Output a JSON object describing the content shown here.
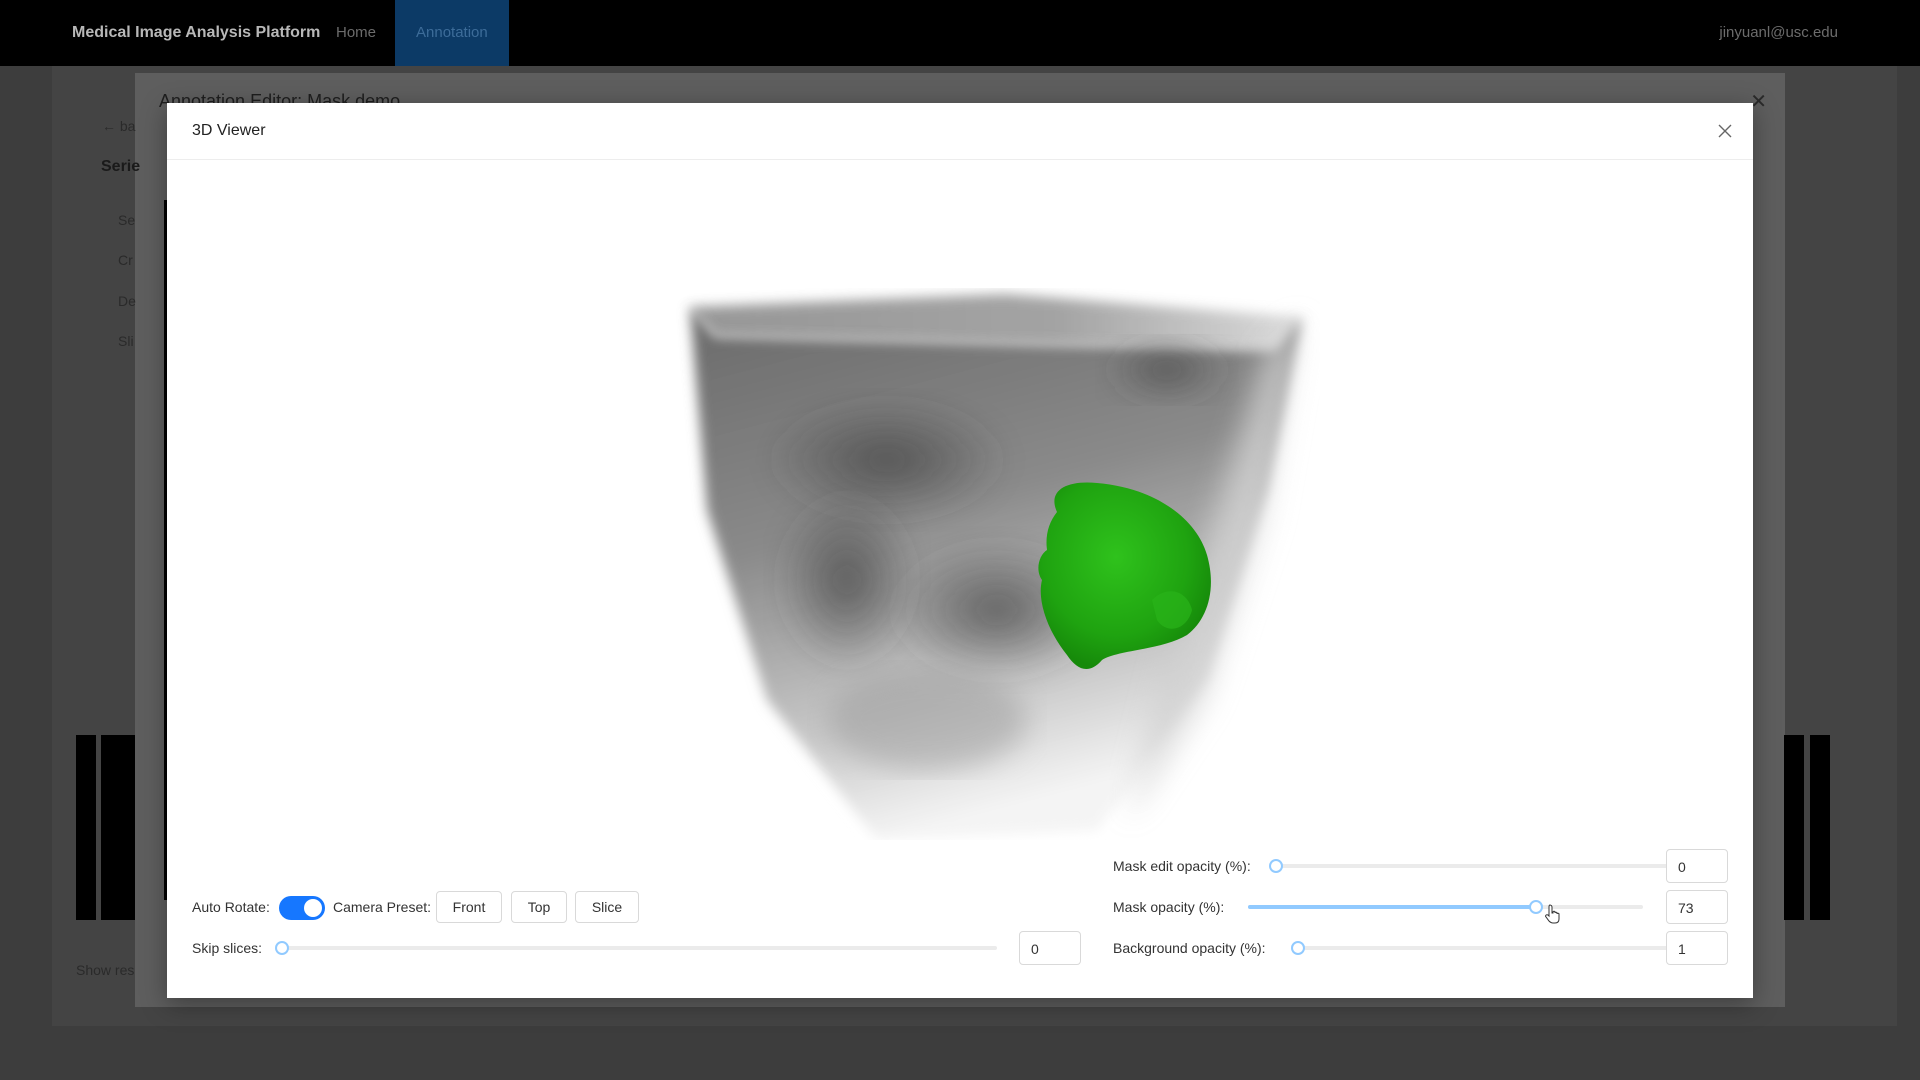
{
  "app": {
    "brand": "Medical Image Analysis Platform",
    "nav": [
      "Home",
      "Annotation"
    ],
    "user": "jinyuanl@usc.edu"
  },
  "background": {
    "editor_title": "Annotation Editor: Mask demo",
    "back_label": "ba",
    "section_label": "Serie",
    "side_items": [
      "Se",
      "Cr",
      "De",
      "Sli"
    ],
    "show_results_label": "Show res"
  },
  "viewer": {
    "title": "3D Viewer",
    "auto_rotate_label": "Auto Rotate:",
    "auto_rotate_on": true,
    "camera_preset_label": "Camera Preset:",
    "camera_presets": [
      "Front",
      "Top",
      "Slice"
    ],
    "skip_slices_label": "Skip slices:",
    "skip_slices_value": "0",
    "mask_edit_opacity_label": "Mask edit opacity (%):",
    "mask_edit_opacity_value": "0",
    "mask_opacity_label": "Mask opacity (%):",
    "mask_opacity_value": "73",
    "background_opacity_label": "Background opacity (%):",
    "background_opacity_value": "1",
    "colors": {
      "accent": "#1677ff",
      "mask": "#22a814",
      "slider": "#91caff"
    }
  }
}
